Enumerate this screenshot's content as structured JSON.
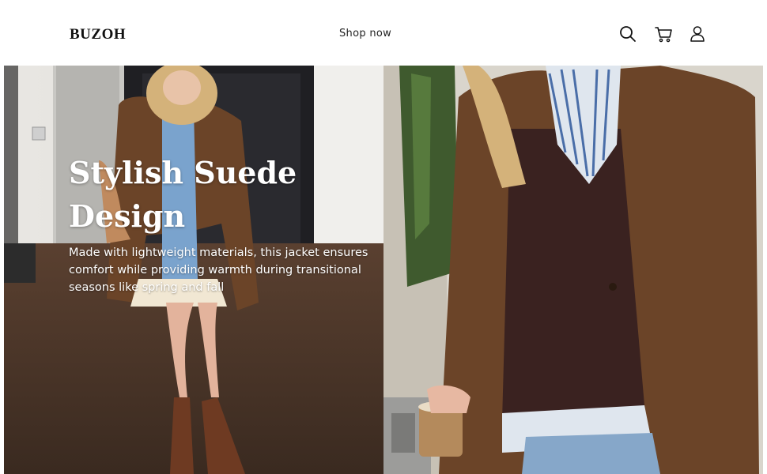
{
  "header": {
    "logo": "BUZOH",
    "nav": {
      "shop_now": "Shop now"
    },
    "icons": [
      "search-icon",
      "cart-icon",
      "account-icon"
    ]
  },
  "hero": {
    "title_line1": "Stylish Suede",
    "title_line2": "Design",
    "description": "Made with lightweight materials, this jacket ensures comfort while providing warmth during transitional seasons like spring and fall"
  },
  "colors": {
    "suede_brown": "#6b4428",
    "sweater_brown": "#3a2220",
    "floor_wood": "#4a3326",
    "text_on_image": "#ffffff"
  }
}
